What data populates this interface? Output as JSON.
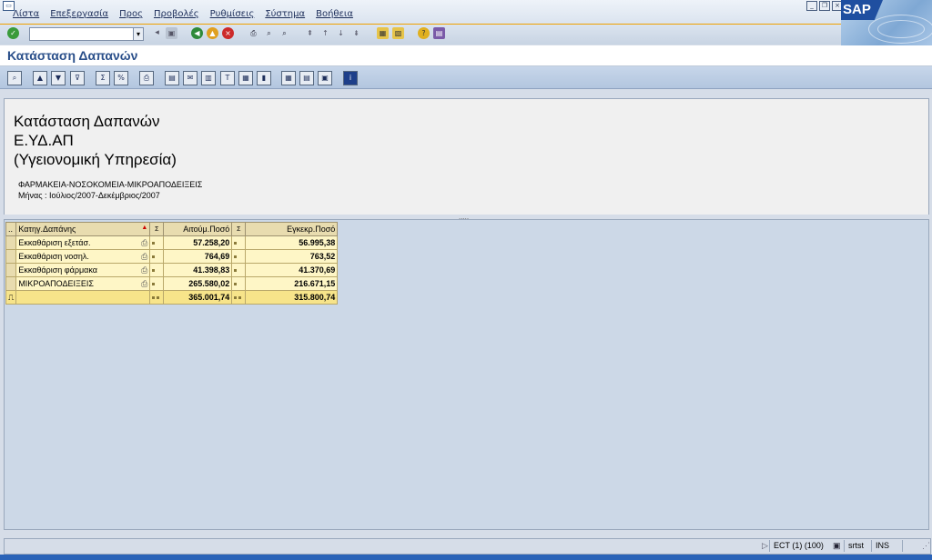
{
  "menu": {
    "items": [
      "Λίστα",
      "Επεξεργασία",
      "Προς",
      "Προβολές",
      "Ρυθμίσεις",
      "Σύστημα",
      "Βοήθεια"
    ]
  },
  "logo": {
    "text": "SAP"
  },
  "page": {
    "title": "Κατάσταση Δαπανών"
  },
  "header": {
    "line1": "Κατάσταση Δαπανών",
    "line2": "Ε.ΥΔ.ΑΠ",
    "line3": "(Υγειονομική Υπηρεσία)",
    "line4": "ΦΑΡΜΑΚΕΙΑ-ΝΟΣΟΚΟΜΕΙΑ-ΜΙΚΡΟΑΠΟΔΕΙΞΕΙΣ",
    "line5": "Μήνας : Ιούλιος/2007-Δεκέμβριος/2007"
  },
  "grid": {
    "col_category": "Κατηγ.Δαπάνης",
    "col_sigma1": "Σ",
    "col_requested": "Αιτούμ.Ποσό",
    "col_sigma2": "Σ",
    "col_approved": "Εγκεκρ.Ποσό",
    "rows": [
      {
        "category": "Εκκαθάριση εξετάσ.",
        "requested": "57.258,20",
        "approved": "56.995,38"
      },
      {
        "category": "Εκκαθάριση νοσηλ.",
        "requested": "764,69",
        "approved": "763,52"
      },
      {
        "category": "Εκκαθάριση φάρμακα",
        "requested": "41.398,83",
        "approved": "41.370,69"
      },
      {
        "category": "ΜΙΚΡΟΑΠΟΔΕΙΞΕΙΣ",
        "requested": "265.580,02",
        "approved": "216.671,15"
      }
    ],
    "total": {
      "requested": "365.001,74",
      "approved": "315.800,74"
    }
  },
  "status": {
    "system": "ECT (1) (100)",
    "server": "srtst",
    "mode": "INS"
  }
}
